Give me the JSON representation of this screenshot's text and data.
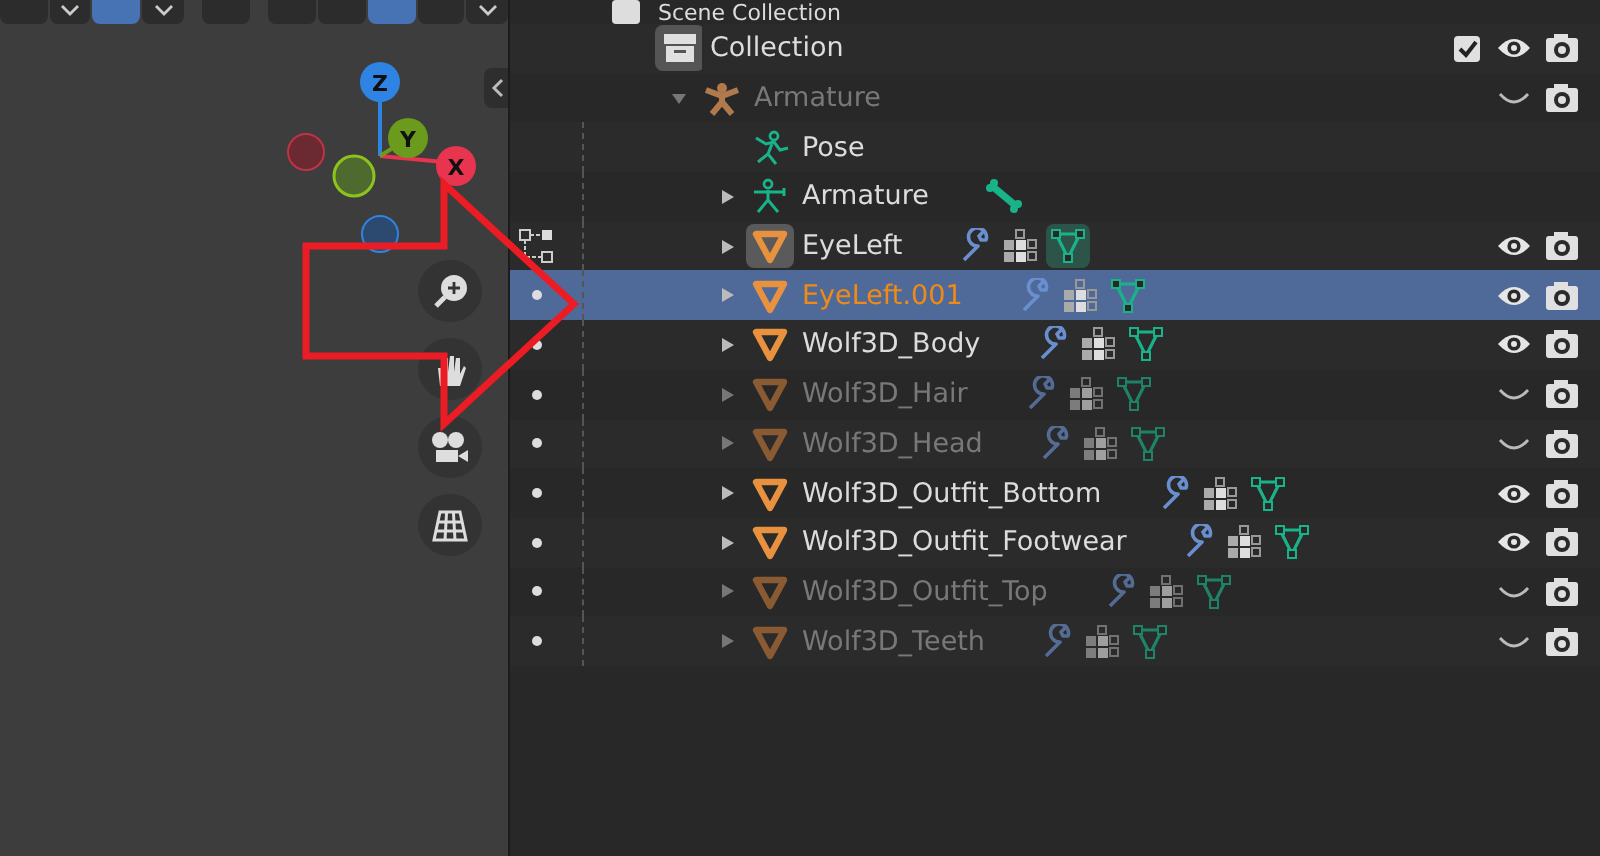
{
  "viewport": {
    "gizmo": {
      "axes": [
        {
          "label": "Z",
          "color": "#2f84e3"
        },
        {
          "label": "Y",
          "color": "#6a9b1d"
        },
        {
          "label": "X",
          "color": "#e8344e"
        }
      ]
    }
  },
  "outliner": {
    "tree": [
      {
        "name": "Scene Collection",
        "kind": "scene",
        "children": [
          {
            "name": "Collection",
            "kind": "collection",
            "checked": true,
            "visible": true,
            "children": [
              {
                "name": "Armature",
                "kind": "armature",
                "expanded": true,
                "dimmed": true,
                "visible": false,
                "children": [
                  {
                    "name": "Pose",
                    "kind": "pose"
                  },
                  {
                    "name": "Armature",
                    "kind": "armature_data",
                    "expanded": false
                  },
                  {
                    "name": "EyeLeft",
                    "kind": "mesh",
                    "expanded": false,
                    "active": true,
                    "selected": false,
                    "dimmed": false,
                    "visible": true
                  },
                  {
                    "name": "EyeLeft.001",
                    "kind": "mesh",
                    "expanded": false,
                    "active": false,
                    "selected": true,
                    "dimmed": false,
                    "visible": true
                  },
                  {
                    "name": "Wolf3D_Body",
                    "kind": "mesh",
                    "expanded": false,
                    "active": false,
                    "selected": false,
                    "dimmed": false,
                    "visible": true
                  },
                  {
                    "name": "Wolf3D_Hair",
                    "kind": "mesh",
                    "expanded": false,
                    "active": false,
                    "selected": false,
                    "dimmed": true,
                    "visible": false
                  },
                  {
                    "name": "Wolf3D_Head",
                    "kind": "mesh",
                    "expanded": false,
                    "active": false,
                    "selected": false,
                    "dimmed": true,
                    "visible": false
                  },
                  {
                    "name": "Wolf3D_Outfit_Bottom",
                    "kind": "mesh",
                    "expanded": false,
                    "active": false,
                    "selected": false,
                    "dimmed": false,
                    "visible": true
                  },
                  {
                    "name": "Wolf3D_Outfit_Footwear",
                    "kind": "mesh",
                    "expanded": false,
                    "active": false,
                    "selected": false,
                    "dimmed": false,
                    "visible": true
                  },
                  {
                    "name": "Wolf3D_Outfit_Top",
                    "kind": "mesh",
                    "expanded": false,
                    "active": false,
                    "selected": false,
                    "dimmed": true,
                    "visible": false
                  },
                  {
                    "name": "Wolf3D_Teeth",
                    "kind": "mesh",
                    "expanded": false,
                    "active": false,
                    "selected": false,
                    "dimmed": true,
                    "visible": false
                  }
                ]
              }
            ]
          }
        ]
      }
    ]
  }
}
